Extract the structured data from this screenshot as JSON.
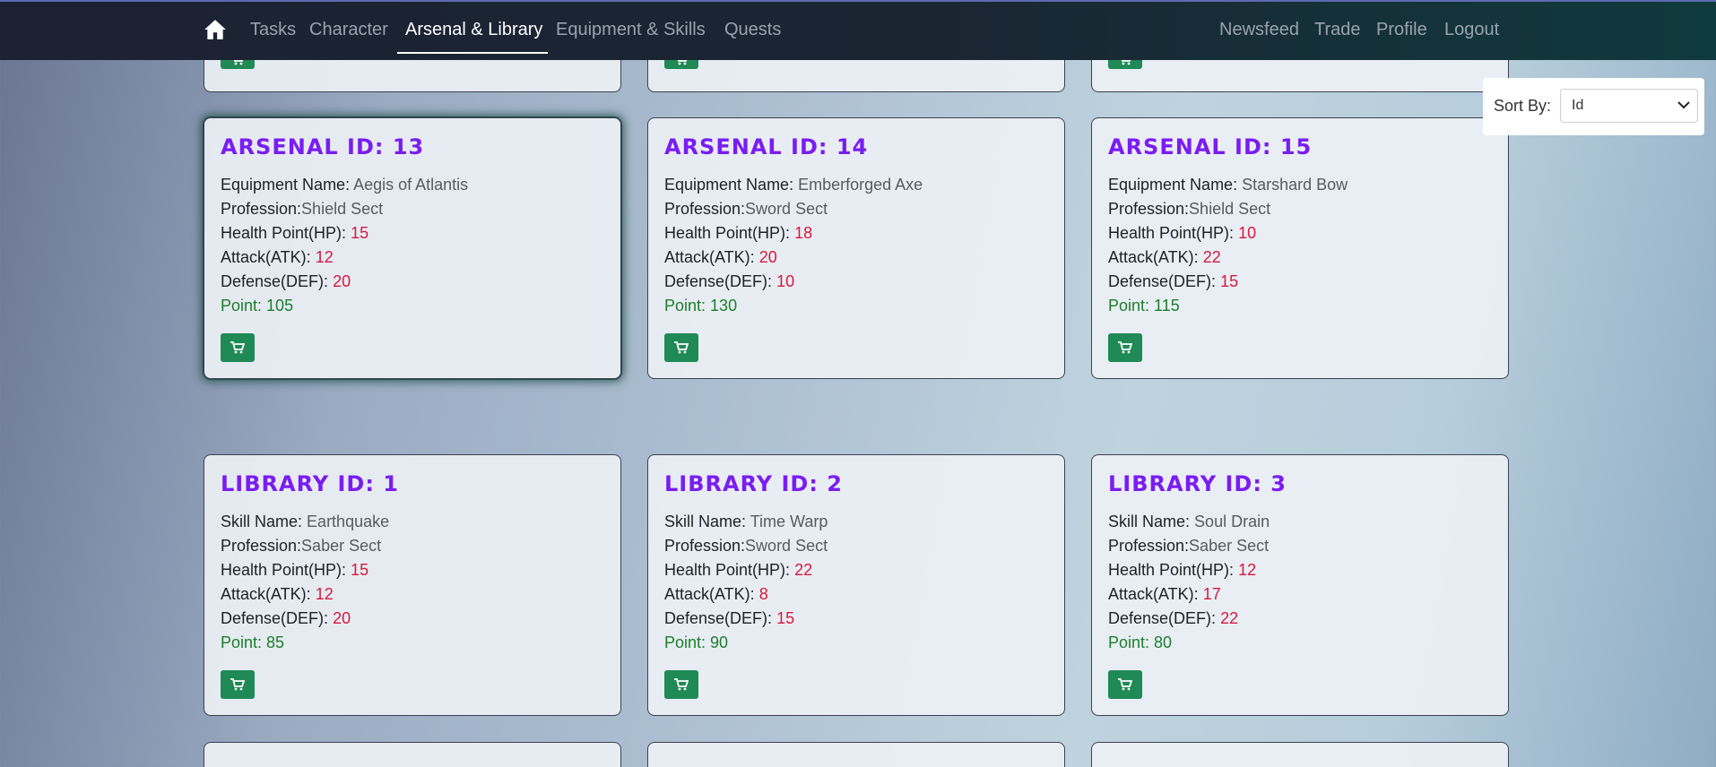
{
  "nav": {
    "home_icon": "home-icon",
    "links": [
      "Tasks",
      "Character",
      "Arsenal & Library",
      "Equipment & Skills",
      "Quests"
    ],
    "active": "Arsenal & Library",
    "right_links": [
      "Newsfeed",
      "Trade",
      "Profile",
      "Logout"
    ]
  },
  "sort": {
    "label": "Sort By:",
    "value": "Id"
  },
  "labels": {
    "equipment_name": "Equipment Name:",
    "skill_name": "Skill Name:",
    "profession": "Profession:",
    "hp": "Health Point(HP):",
    "atk": "Attack(ATK):",
    "def": "Defense(DEF):",
    "point": "Point:"
  },
  "arsenal": [
    {
      "title": "ARSENAL ID: 13",
      "name": "Aegis of Atlantis",
      "profession": "Shield Sect",
      "hp": "15",
      "atk": "12",
      "def": "20",
      "point": "105"
    },
    {
      "title": "ARSENAL ID: 14",
      "name": "Emberforged Axe",
      "profession": "Sword Sect",
      "hp": "18",
      "atk": "20",
      "def": "10",
      "point": "130"
    },
    {
      "title": "ARSENAL ID: 15",
      "name": "Starshard Bow",
      "profession": "Shield Sect",
      "hp": "10",
      "atk": "22",
      "def": "15",
      "point": "115"
    }
  ],
  "library": [
    {
      "title": "LIBRARY ID: 1",
      "name": "Earthquake",
      "profession": "Saber Sect",
      "hp": "15",
      "atk": "12",
      "def": "20",
      "point": "85"
    },
    {
      "title": "LIBRARY ID: 2",
      "name": "Time Warp",
      "profession": "Sword Sect",
      "hp": "22",
      "atk": "8",
      "def": "15",
      "point": "90"
    },
    {
      "title": "LIBRARY ID: 3",
      "name": "Soul Drain",
      "profession": "Saber Sect",
      "hp": "12",
      "atk": "17",
      "def": "22",
      "point": "80"
    }
  ],
  "icons": {
    "cart": "cart-icon",
    "chevron": "chevron-down-icon"
  },
  "colors": {
    "title": "#7a1cf2",
    "stat_value": "#d8183c",
    "point": "#1d7e2a",
    "cart_button": "#1f8a55",
    "nav_bg": "#1c2233"
  }
}
